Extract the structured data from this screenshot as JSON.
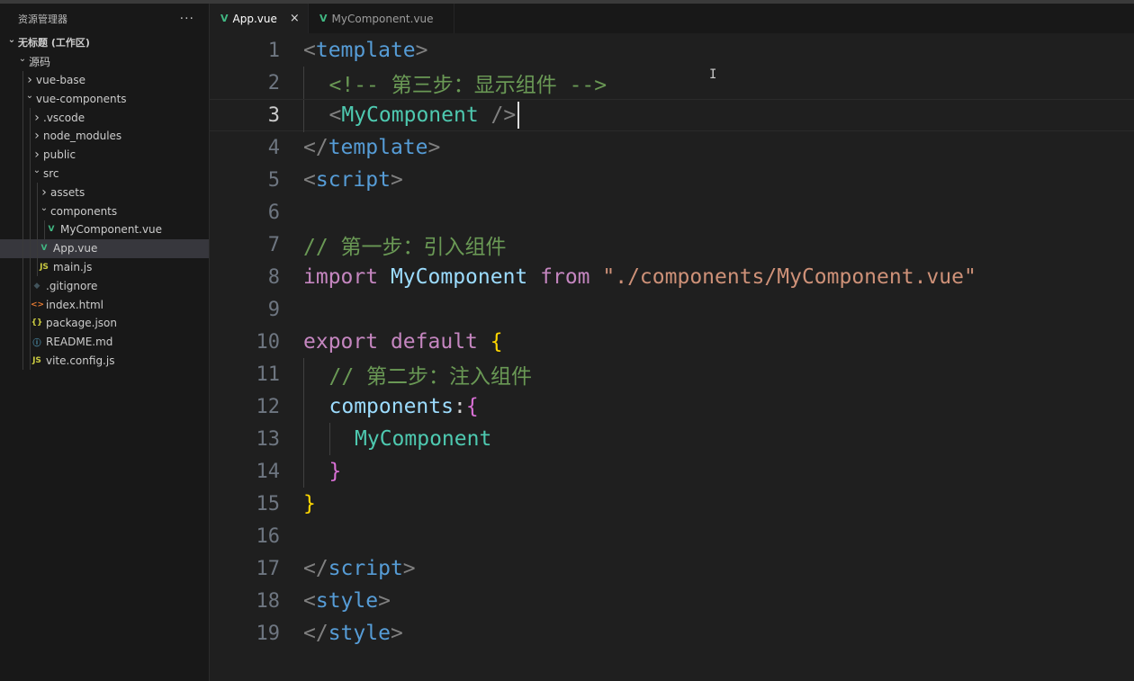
{
  "sidebar": {
    "title": "资源管理器",
    "more": "···",
    "tree": [
      {
        "label": "无标题 (工作区)",
        "depth": 0,
        "chevron": "down",
        "bold": true
      },
      {
        "label": "源码",
        "depth": 1,
        "chevron": "down"
      },
      {
        "label": "vue-base",
        "depth": 2,
        "chevron": "right"
      },
      {
        "label": "vue-components",
        "depth": 2,
        "chevron": "down"
      },
      {
        "label": ".vscode",
        "depth": 3,
        "chevron": "right"
      },
      {
        "label": "node_modules",
        "depth": 3,
        "chevron": "right"
      },
      {
        "label": "public",
        "depth": 3,
        "chevron": "right"
      },
      {
        "label": "src",
        "depth": 3,
        "chevron": "down"
      },
      {
        "label": "assets",
        "depth": 4,
        "chevron": "right"
      },
      {
        "label": "components",
        "depth": 4,
        "chevron": "down"
      },
      {
        "label": "MyComponent.vue",
        "depth": 5,
        "icon": "vue-icon",
        "glyph": "V",
        "color": "#41b883"
      },
      {
        "label": "App.vue",
        "depth": 4,
        "icon": "vue-icon",
        "glyph": "V",
        "color": "#41b883",
        "selected": true
      },
      {
        "label": "main.js",
        "depth": 4,
        "icon": "js-icon",
        "glyph": "JS",
        "color": "#cbcb41"
      },
      {
        "label": ".gitignore",
        "depth": 3,
        "icon": "git-icon",
        "glyph": "◆",
        "color": "#41535b"
      },
      {
        "label": "index.html",
        "depth": 3,
        "icon": "html-icon",
        "glyph": "<>",
        "color": "#e37933"
      },
      {
        "label": "package.json",
        "depth": 3,
        "icon": "json-icon",
        "glyph": "{}",
        "color": "#cbcb41"
      },
      {
        "label": "README.md",
        "depth": 3,
        "icon": "info-icon",
        "glyph": "ⓘ",
        "color": "#519aba"
      },
      {
        "label": "vite.config.js",
        "depth": 3,
        "icon": "js-icon",
        "glyph": "JS",
        "color": "#cbcb41"
      }
    ]
  },
  "tabs": [
    {
      "label": "App.vue",
      "active": true,
      "close": "×"
    },
    {
      "label": "MyComponent.vue",
      "active": false
    }
  ],
  "editor": {
    "active_line": 3,
    "lines": [
      {
        "n": "1",
        "indent": 0,
        "tokens": [
          [
            "punc",
            "<"
          ],
          [
            "tag",
            "template"
          ],
          [
            "punc",
            ">"
          ]
        ]
      },
      {
        "n": "2",
        "indent": 1,
        "tokens": [
          [
            "cmt",
            "<!-- 第三步：显示组件 -->"
          ]
        ]
      },
      {
        "n": "3",
        "indent": 1,
        "tokens": [
          [
            "punc",
            "<"
          ],
          [
            "comp",
            "MyComponent"
          ],
          [
            "punc",
            " />"
          ]
        ],
        "cursor": true
      },
      {
        "n": "4",
        "indent": 0,
        "tokens": [
          [
            "punc",
            "</"
          ],
          [
            "tag",
            "template"
          ],
          [
            "punc",
            ">"
          ]
        ]
      },
      {
        "n": "5",
        "indent": 0,
        "tokens": [
          [
            "punc",
            "<"
          ],
          [
            "tag",
            "script"
          ],
          [
            "punc",
            ">"
          ]
        ]
      },
      {
        "n": "6",
        "indent": 0,
        "tokens": []
      },
      {
        "n": "7",
        "indent": 0,
        "tokens": [
          [
            "cmt",
            "// 第一步：引入组件"
          ]
        ]
      },
      {
        "n": "8",
        "indent": 0,
        "tokens": [
          [
            "kw",
            "import"
          ],
          [
            "plain",
            " "
          ],
          [
            "var",
            "MyComponent"
          ],
          [
            "plain",
            " "
          ],
          [
            "kw",
            "from"
          ],
          [
            "plain",
            " "
          ],
          [
            "str",
            "\"./components/MyComponent.vue\""
          ]
        ]
      },
      {
        "n": "9",
        "indent": 0,
        "tokens": []
      },
      {
        "n": "10",
        "indent": 0,
        "tokens": [
          [
            "kw",
            "export"
          ],
          [
            "plain",
            " "
          ],
          [
            "kw",
            "default"
          ],
          [
            "plain",
            " "
          ],
          [
            "b1",
            "{"
          ]
        ]
      },
      {
        "n": "11",
        "indent": 1,
        "tokens": [
          [
            "cmt",
            "// 第二步：注入组件"
          ]
        ]
      },
      {
        "n": "12",
        "indent": 1,
        "tokens": [
          [
            "var",
            "components"
          ],
          [
            "plain",
            ":"
          ],
          [
            "b2",
            "{"
          ]
        ]
      },
      {
        "n": "13",
        "indent": 2,
        "tokens": [
          [
            "comp",
            "MyComponent"
          ]
        ]
      },
      {
        "n": "14",
        "indent": 1,
        "tokens": [
          [
            "b2",
            "}"
          ]
        ]
      },
      {
        "n": "15",
        "indent": 0,
        "tokens": [
          [
            "b1",
            "}"
          ]
        ]
      },
      {
        "n": "16",
        "indent": 0,
        "tokens": []
      },
      {
        "n": "17",
        "indent": 0,
        "tokens": [
          [
            "punc",
            "</"
          ],
          [
            "tag",
            "script"
          ],
          [
            "punc",
            ">"
          ]
        ]
      },
      {
        "n": "18",
        "indent": 0,
        "tokens": [
          [
            "punc",
            "<"
          ],
          [
            "tag",
            "style"
          ],
          [
            "punc",
            ">"
          ]
        ]
      },
      {
        "n": "19",
        "indent": 0,
        "tokens": [
          [
            "punc",
            "</"
          ],
          [
            "tag",
            "style"
          ],
          [
            "punc",
            ">"
          ]
        ]
      }
    ]
  },
  "colors": {
    "accent": "#41b883",
    "background": "#1f1f1f",
    "sidebar": "#181818"
  }
}
